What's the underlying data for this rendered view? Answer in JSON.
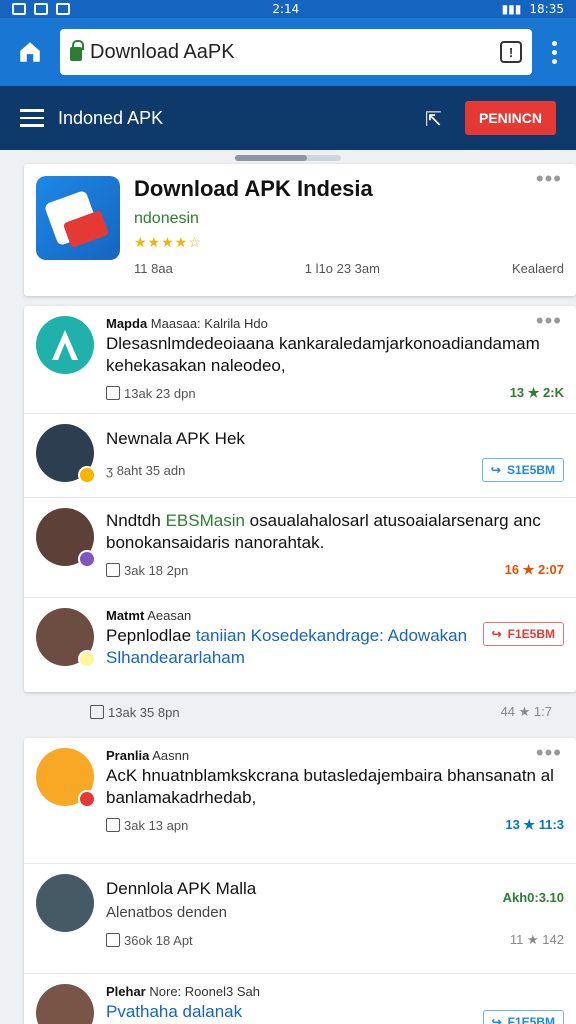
{
  "status": {
    "time_center": "2:14",
    "time_right": "18:35"
  },
  "browser": {
    "url": "Download AaPK",
    "tab_label": "!"
  },
  "appbar": {
    "title": "Indoned APK",
    "action_label": "PENINCN"
  },
  "hero": {
    "title": "Download APK Indesia",
    "subtitle": "ndonesin",
    "stars": "★★★★☆",
    "meta_left": "11 8aa",
    "meta_mid": "1 l1o  23  3am",
    "meta_right": "Kealaerd"
  },
  "posts_card1": [
    {
      "name": "Mapda",
      "handle": "Maasaa: Kalrila Hdo",
      "text_a": "Dlesasnlmdedeoiaana kankaraledamjarkonoadiandamam kehekasakan naleodeo,",
      "text_b": "",
      "meta_left": "13ak  23  dpn",
      "meta_right": "13 ★ 2:K",
      "right_kind": "stars-green"
    },
    {
      "name": "",
      "handle": "",
      "text_a": "Newnala APK Hek",
      "text_b": "",
      "meta_left": "ʒ 8aht  35  adn",
      "meta_right": "S1E5BM",
      "right_kind": "btn-blue"
    },
    {
      "name": "",
      "handle": "",
      "text_a": "Nndtdh",
      "text_g": "EBSMasin",
      "text_c": "osaualahalosarl atusoaialarsenarg anc bonokansaidaris nanorahtak.",
      "meta_left": "3ak  18  2pn",
      "meta_right": "16 ★ 2:07",
      "right_kind": "stars-orange"
    },
    {
      "name": "Matmt",
      "handle": "Aeasan",
      "text_a": "Pepnlodlae",
      "text_bl": "taniian Kosedekandrage: Adowakan Slhandeararlaham",
      "meta_left": "",
      "meta_right": "F1E5BM",
      "right_kind": "btn-red"
    }
  ],
  "between": {
    "meta_left": "13ak  35  8pn",
    "meta_right": "44 ★ 1:7"
  },
  "posts_card2": [
    {
      "name": "Pranlia",
      "handle": "Aasnn",
      "text_a": "AcK hnuatnblamkskcrana butasledajembaira bhansanatn al banlamakadrhedab,",
      "meta_left": "3ak  13  apn",
      "meta_right": "13 ★ 11:3",
      "right_kind": "stars-blue"
    },
    {
      "name": "",
      "handle": "",
      "text_a": "Dennlola APK Malla",
      "text_sub": "Alenatbos denden",
      "meta_left": "",
      "meta_right": "Akh0:3.10",
      "right_kind": "stars-green2"
    },
    {
      "name": "",
      "handle": "",
      "text_a": "",
      "meta_left": "36ok  18  Apt",
      "meta_right": "11 ★ 142",
      "right_kind": "stars-gray"
    },
    {
      "name": "Plehar",
      "handle": "Nore: Roonel3 Sah",
      "text_bl": "Pvathaha dalanak",
      "meta_left": "",
      "meta_right": "F1E5BM",
      "right_kind": "btn-blue"
    }
  ]
}
